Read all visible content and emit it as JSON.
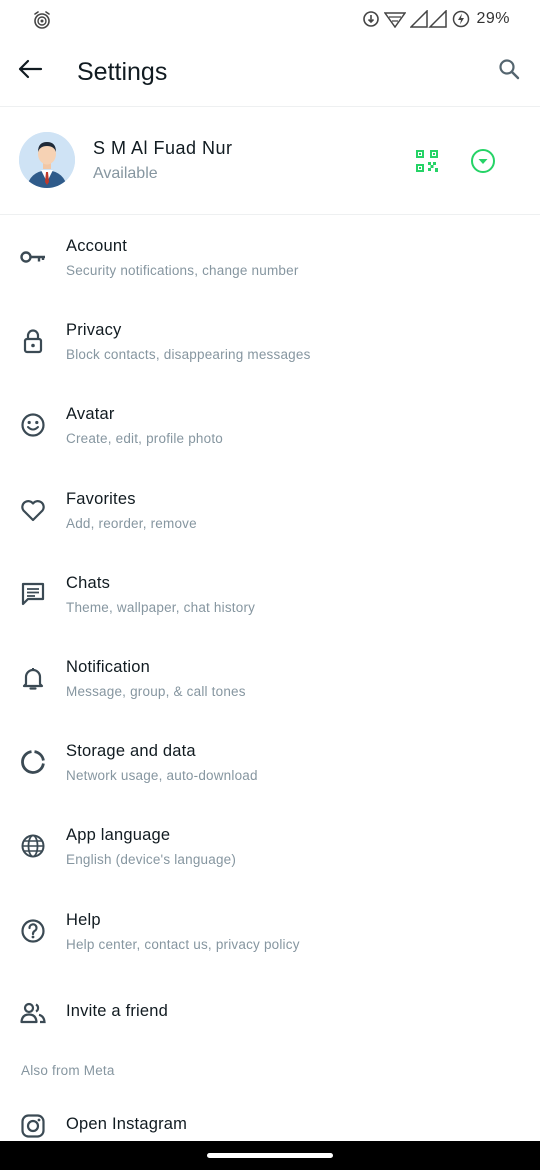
{
  "status_bar": {
    "battery_percent": "29%",
    "icons": [
      "alarm-icon",
      "data-saver-icon",
      "wifi-icon",
      "signal-icon",
      "battery-icon"
    ]
  },
  "appbar": {
    "title": "Settings",
    "back_icon": "arrow-left-icon",
    "search_icon": "search-icon"
  },
  "profile": {
    "name": "S M Al Fuad Nur",
    "status": "Available",
    "qr_icon": "qr-code-icon",
    "expand_icon": "chevron-down-circle-icon"
  },
  "colors": {
    "accent": "#25d366",
    "text_primary": "#111b21",
    "text_secondary": "#8696a0",
    "icon": "#54656f"
  },
  "menu": {
    "items": [
      {
        "label": "Account",
        "sub": "Security notifications, change number",
        "icon": "key-icon"
      },
      {
        "label": "Privacy",
        "sub": "Block contacts, disappearing messages",
        "icon": "lock-icon"
      },
      {
        "label": "Avatar",
        "sub": "Create, edit, profile photo",
        "icon": "smiley-icon"
      },
      {
        "label": "Favorites",
        "sub": "Add, reorder, remove",
        "icon": "heart-icon"
      },
      {
        "label": "Chats",
        "sub": "Theme, wallpaper, chat history",
        "icon": "chat-icon"
      },
      {
        "label": "Notification",
        "sub": "Message, group, & call tones",
        "icon": "bell-icon"
      },
      {
        "label": "Storage and data",
        "sub": "Network usage, auto-download",
        "icon": "storage-icon"
      },
      {
        "label": "App language",
        "sub": "English (device's language)",
        "icon": "globe-icon"
      },
      {
        "label": "Help",
        "sub": "Help center, contact us, privacy policy",
        "icon": "help-icon"
      },
      {
        "label": "Invite a friend",
        "icon": "people-icon"
      }
    ]
  },
  "meta_section": {
    "label": "Also from Meta",
    "items": [
      {
        "label": "Open Instagram",
        "icon": "instagram-icon"
      }
    ]
  }
}
